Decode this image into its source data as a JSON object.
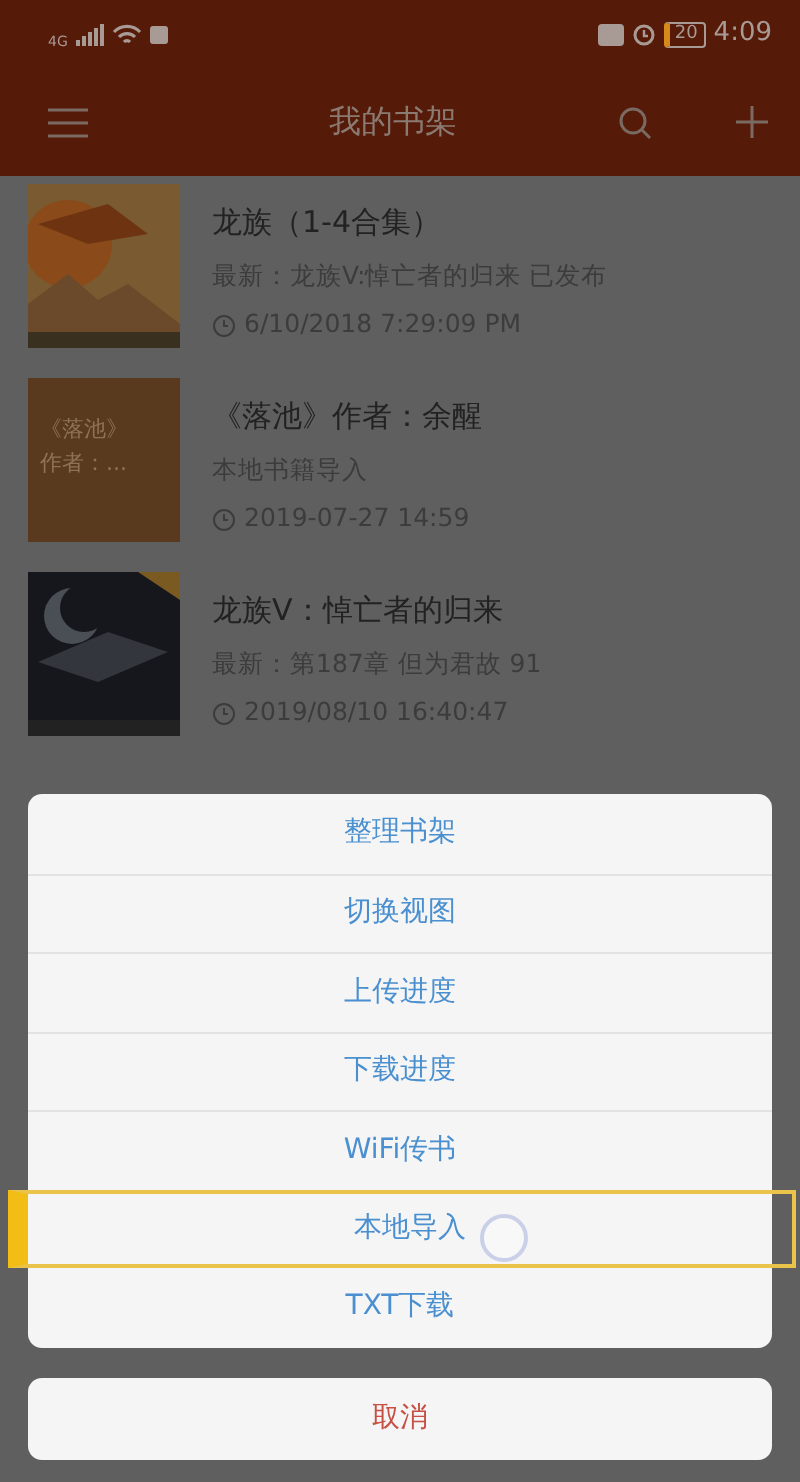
{
  "status_bar": {
    "network": "4G",
    "time": "4:09",
    "battery": "20"
  },
  "toolbar": {
    "title": "我的书架"
  },
  "books": [
    {
      "title": "龙族（1-4合集）",
      "subtitle": "最新：龙族V:悼亡者的归来 已发布",
      "time": "6/10/2018 7:29:09 PM"
    },
    {
      "title": "《落池》作者：余醒",
      "subtitle": "本地书籍导入",
      "time": "2019-07-27 14:59",
      "cover": {
        "kind": "text",
        "lines": [
          "《落池》",
          "作者：..."
        ]
      }
    },
    {
      "title": "龙族V：悼亡者的归来",
      "subtitle": "最新：第187章 但为君故 91",
      "time": "2019/08/10 16:40:47"
    }
  ],
  "action_sheet": {
    "items": [
      {
        "label": "整理书架",
        "selected": false
      },
      {
        "label": "切换视图",
        "selected": false
      },
      {
        "label": "上传进度",
        "selected": false
      },
      {
        "label": "下载进度",
        "selected": false
      },
      {
        "label": "WiFi传书",
        "selected": false
      },
      {
        "label": "本地导入",
        "selected": true
      },
      {
        "label": "TXT下载",
        "selected": false
      }
    ],
    "cancel": "取消"
  }
}
